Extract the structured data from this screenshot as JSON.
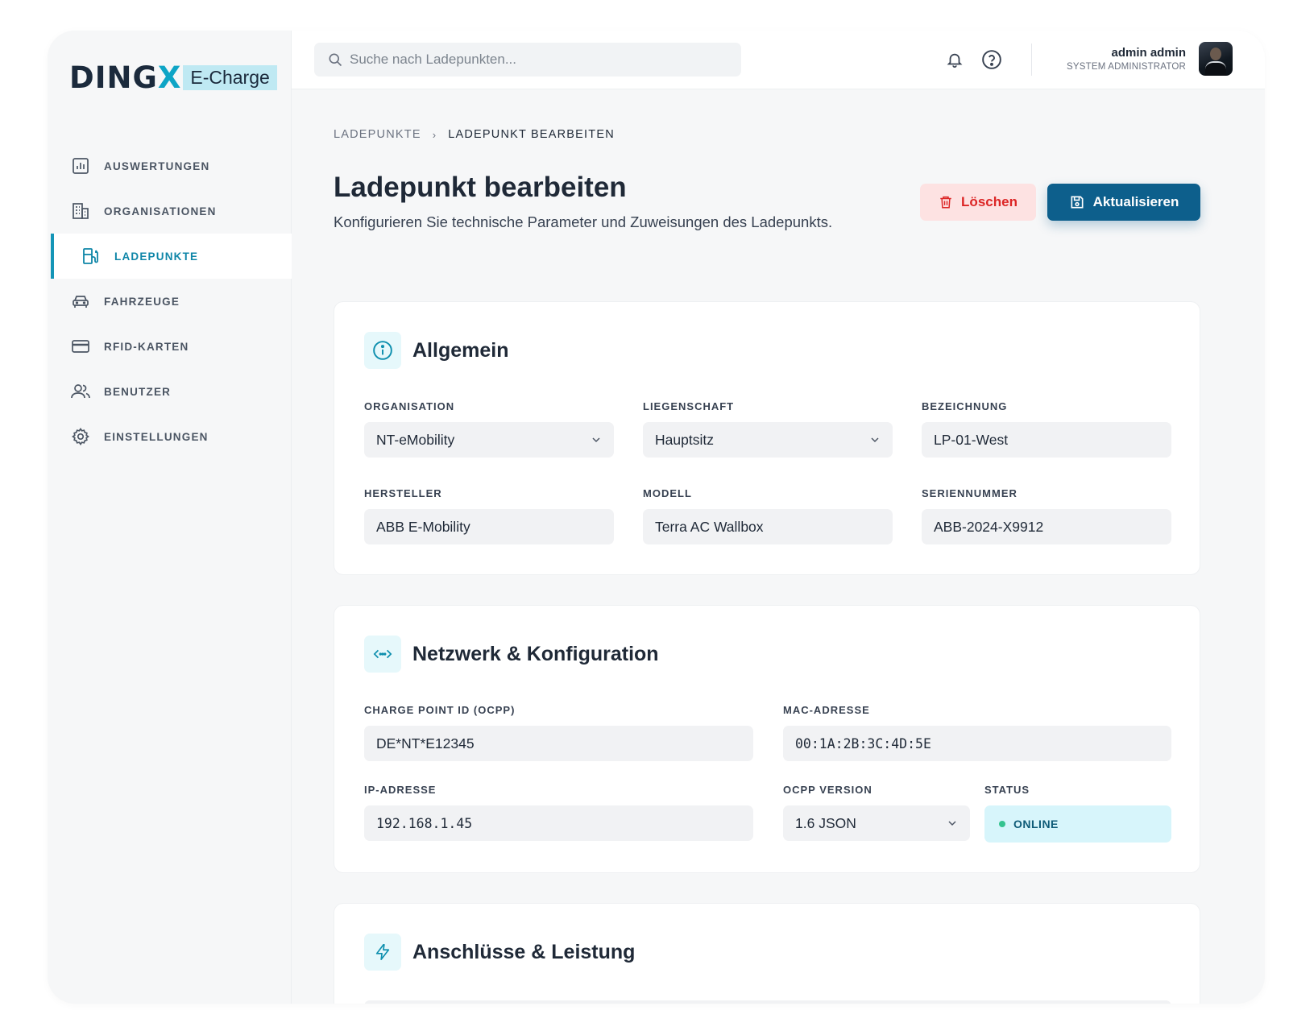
{
  "brand": {
    "name_main": "DING",
    "name_x": "X",
    "name_sub": "E-Charge"
  },
  "search": {
    "placeholder": "Suche nach Ladepunkten..."
  },
  "user": {
    "name": "admin admin",
    "role": "SYSTEM ADMINISTRATOR"
  },
  "sidebar": {
    "items": [
      {
        "label": "AUSWERTUNGEN",
        "icon": "chart-icon"
      },
      {
        "label": "ORGANISATIONEN",
        "icon": "building-icon"
      },
      {
        "label": "LADEPUNKTE",
        "icon": "charging-station-icon",
        "active": true
      },
      {
        "label": "FAHRZEUGE",
        "icon": "car-icon"
      },
      {
        "label": "RFID-KARTEN",
        "icon": "card-icon"
      },
      {
        "label": "BENUTZER",
        "icon": "users-icon"
      },
      {
        "label": "EINSTELLUNGEN",
        "icon": "gear-icon"
      }
    ]
  },
  "breadcrumb": {
    "parent": "LADEPUNKTE",
    "separator": "›",
    "current": "LADEPUNKT BEARBEITEN"
  },
  "page": {
    "title": "Ladepunkt bearbeiten",
    "subtitle": "Konfigurieren Sie technische Parameter und Zuweisungen des Ladepunkts."
  },
  "actions": {
    "delete_label": "Löschen",
    "update_label": "Aktualisieren"
  },
  "colors": {
    "accent": "#0d5f8c",
    "teal": "#0e8fae",
    "danger": "#dc2626",
    "online": "#34c38f"
  },
  "general": {
    "title": "Allgemein",
    "organisation": {
      "label": "ORGANISATION",
      "value": "NT-eMobility"
    },
    "liegenschaft": {
      "label": "LIEGENSCHAFT",
      "value": "Hauptsitz"
    },
    "bezeichnung": {
      "label": "BEZEICHNUNG",
      "value": "LP-01-West"
    },
    "hersteller": {
      "label": "HERSTELLER",
      "value": "ABB E-Mobility"
    },
    "modell": {
      "label": "MODELL",
      "value": "Terra AC Wallbox"
    },
    "seriennummer": {
      "label": "SERIENNUMMER",
      "value": "ABB-2024-X9912"
    }
  },
  "network": {
    "title": "Netzwerk & Konfiguration",
    "charge_point_id": {
      "label": "CHARGE POINT ID (OCPP)",
      "value": "DE*NT*E12345"
    },
    "mac": {
      "label": "MAC-ADRESSE",
      "value": "00:1A:2B:3C:4D:5E"
    },
    "ip": {
      "label": "IP-ADRESSE",
      "value": "192.168.1.45"
    },
    "ocpp_version": {
      "label": "OCPP VERSION",
      "value": "1.6 JSON"
    },
    "status": {
      "label": "STATUS",
      "value": "ONLINE"
    }
  },
  "connectors": {
    "title": "Anschlüsse & Leistung"
  }
}
